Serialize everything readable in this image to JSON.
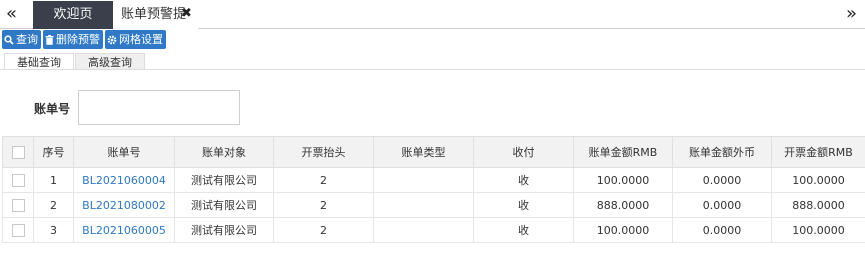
{
  "tabs": {
    "welcome": "欢迎页",
    "bill_alert": "账单预警提醒",
    "close_glyph": "✖",
    "nav_left": "«",
    "nav_right": "»"
  },
  "toolbar": {
    "query": "查询",
    "delete_alert": "删除预警",
    "grid_settings": "网格设置",
    "icons": [
      "search-icon",
      "trash-icon",
      "gear-icon"
    ],
    "button_color": "#2f79c6"
  },
  "search_tabs": {
    "basic": "基础查询",
    "advanced": "高级查询"
  },
  "filter": {
    "bill_no_label": "账单号",
    "bill_no_value": ""
  },
  "grid": {
    "columns": [
      "序号",
      "账单号",
      "账单对象",
      "开票抬头",
      "账单类型",
      "收付",
      "账单金额RMB",
      "账单金额外币",
      "开票金额RMB"
    ],
    "rows": [
      {
        "seq": "1",
        "bill_no": "BL2021060004",
        "object": "测试有限公司",
        "invoice_title": "2",
        "bill_type": "",
        "direction": "收",
        "amount_rmb": "100.0000",
        "amount_fx": "0.0000",
        "invoice_rmb": "100.0000"
      },
      {
        "seq": "2",
        "bill_no": "BL2021080002",
        "object": "测试有限公司",
        "invoice_title": "2",
        "bill_type": "",
        "direction": "收",
        "amount_rmb": "888.0000",
        "amount_fx": "0.0000",
        "invoice_rmb": "888.0000"
      },
      {
        "seq": "3",
        "bill_no": "BL2021060005",
        "object": "测试有限公司",
        "invoice_title": "2",
        "bill_type": "",
        "direction": "收",
        "amount_rmb": "100.0000",
        "amount_fx": "0.0000",
        "invoice_rmb": "100.0000"
      }
    ]
  },
  "colors": {
    "active_tab_bg": "#3a3f4b",
    "link": "#2f79c6",
    "header_bg": "#f2f2f2"
  }
}
